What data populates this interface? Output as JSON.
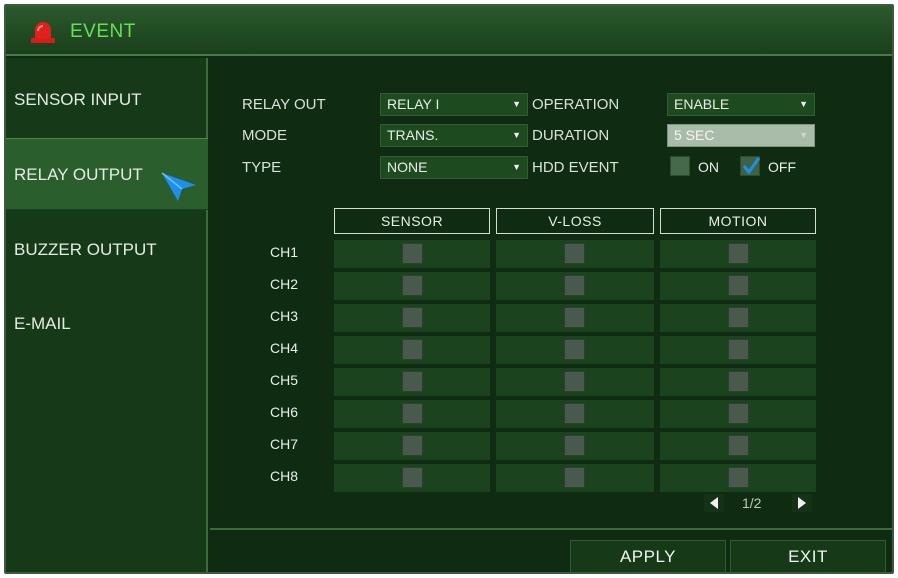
{
  "window": {
    "title": "EVENT",
    "title_icon": "alarm-siren-icon"
  },
  "sidebar": {
    "items": [
      {
        "label": "SENSOR INPUT"
      },
      {
        "label": "RELAY OUTPUT",
        "active": true
      },
      {
        "label": "BUZZER OUTPUT"
      },
      {
        "label": "E-MAIL"
      }
    ]
  },
  "form": {
    "relay_out": {
      "label": "RELAY OUT",
      "value": "RELAY I"
    },
    "mode": {
      "label": "MODE",
      "value": "TRANS."
    },
    "type": {
      "label": "TYPE",
      "value": "NONE"
    },
    "operation": {
      "label": "OPERATION",
      "value": "ENABLE"
    },
    "duration": {
      "label": "DURATION",
      "value": "5 SEC"
    },
    "hdd_event": {
      "label": "HDD EVENT",
      "on_label": "ON",
      "off_label": "OFF",
      "selected": "OFF"
    }
  },
  "grid": {
    "columns": [
      "SENSOR",
      "V-LOSS",
      "MOTION"
    ],
    "rows": [
      "CH1",
      "CH2",
      "CH3",
      "CH4",
      "CH5",
      "CH6",
      "CH7",
      "CH8"
    ]
  },
  "pagination": {
    "text": "1/2"
  },
  "footer": {
    "apply_label": "APPLY",
    "exit_label": "EXIT"
  },
  "colors": {
    "title_text": "#66e054",
    "accent_check": "#1e8fe8",
    "cursor": "#1d8ff0",
    "alarm_red": "#e0201e"
  }
}
